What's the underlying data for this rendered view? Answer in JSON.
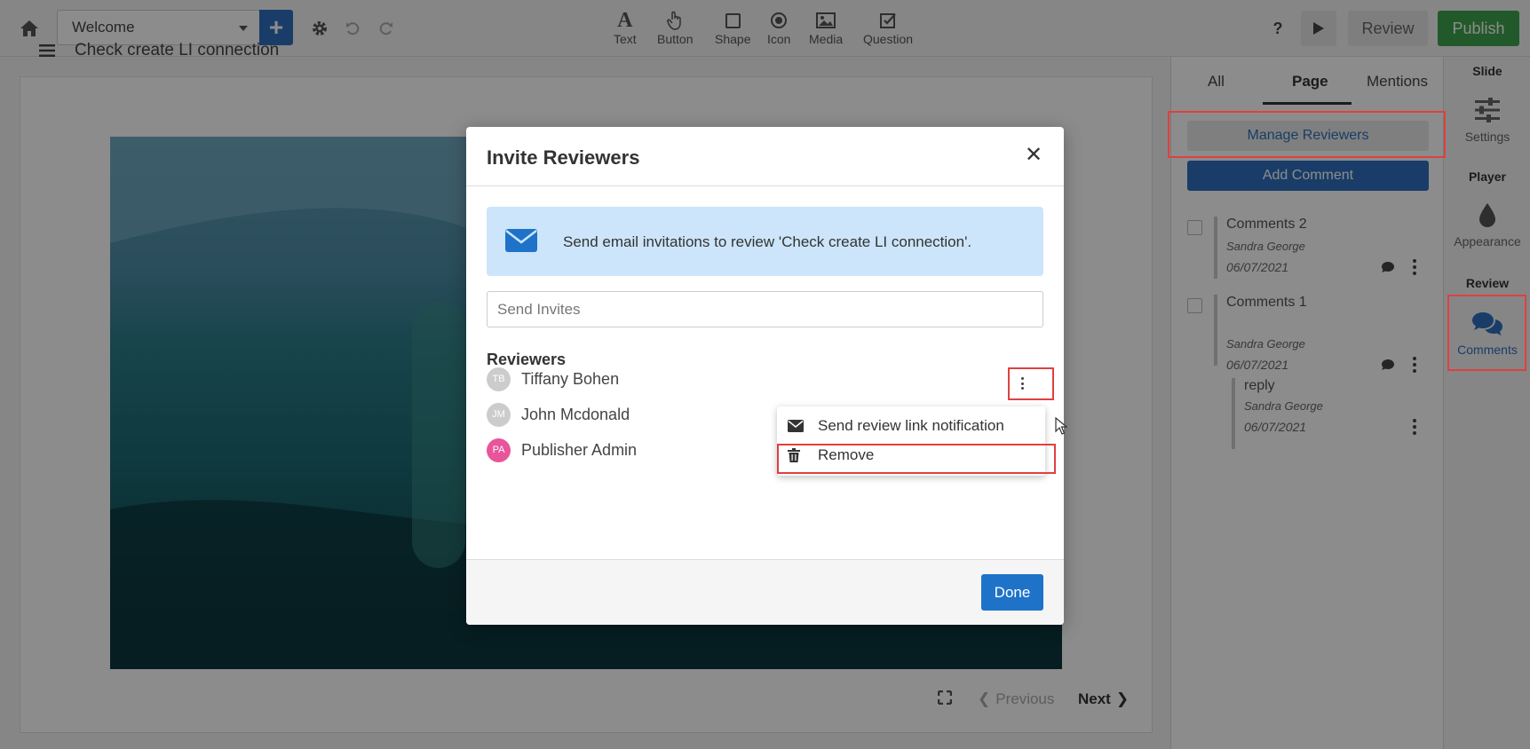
{
  "toolbar": {
    "page_select_value": "Welcome",
    "tools": [
      "Text",
      "Button",
      "Shape",
      "Icon",
      "Media",
      "Question"
    ],
    "help_label": "?",
    "review_label": "Review",
    "publish_label": "Publish"
  },
  "slide": {
    "title": "Check create LI connection",
    "nav_previous": "Previous",
    "nav_next": "Next"
  },
  "comments_panel": {
    "tabs": [
      "All",
      "Page",
      "Mentions"
    ],
    "active_tab": "Page",
    "manage_reviewers_label": "Manage Reviewers",
    "add_comment_label": "Add Comment",
    "comments": [
      {
        "title": "Comments 2",
        "author": "Sandra George",
        "date": "06/07/2021"
      },
      {
        "title": "Comments 1",
        "author": "Sandra George",
        "date": "06/07/2021",
        "reply": {
          "title": "reply",
          "author": "Sandra George",
          "date": "06/07/2021"
        }
      }
    ]
  },
  "side_rail": {
    "slide_heading": "Slide",
    "settings_label": "Settings",
    "player_heading": "Player",
    "appearance_label": "Appearance",
    "review_heading": "Review",
    "comments_label": "Comments"
  },
  "modal": {
    "title": "Invite Reviewers",
    "close_glyph": "✕",
    "info_text": "Send email invitations to review 'Check create LI connection'.",
    "invite_placeholder": "Send Invites",
    "reviewers_heading": "Reviewers",
    "reviewers": [
      {
        "initials": "TB",
        "name": "Tiffany Bohen",
        "color": "#cccccc"
      },
      {
        "initials": "JM",
        "name": "John Mcdonald",
        "color": "#cccccc"
      },
      {
        "initials": "PA",
        "name": "Publisher Admin",
        "color": "#e8559a"
      }
    ],
    "done_label": "Done"
  },
  "context_menu": {
    "items": [
      {
        "label": "Send review link notification",
        "icon": "envelope-icon"
      },
      {
        "label": "Remove",
        "icon": "trash-icon"
      }
    ]
  },
  "colors": {
    "primary_blue": "#2f6fbd",
    "publish_green": "#3fa34d",
    "highlight_red": "#e04040",
    "info_bg": "#cce5fa"
  }
}
